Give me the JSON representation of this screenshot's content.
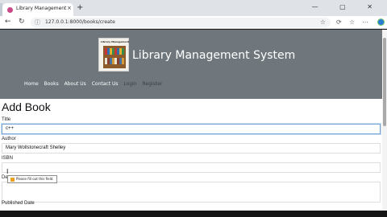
{
  "browser": {
    "tab_title": "Library Management",
    "tab_close": "×",
    "new_tab": "+",
    "window_controls": "— ▢ ✕",
    "url": "127.0.0.1:8000/books/create"
  },
  "site": {
    "title": "Library Management System",
    "logo_text": "Library Management"
  },
  "nav": {
    "items": [
      "Home",
      "Books",
      "About Us",
      "Contact Us",
      "Login",
      "Register"
    ]
  },
  "form": {
    "heading": "Add Book",
    "title_label": "Title",
    "title_value": "c++",
    "author_label": "Author",
    "author_value": "Mary Wollstonecraft Shelley",
    "isbn_label": "ISBN",
    "isbn_value": "",
    "description_label": "Desc",
    "published_label": "Published Date",
    "validation_tooltip": "Please fill out this field."
  }
}
